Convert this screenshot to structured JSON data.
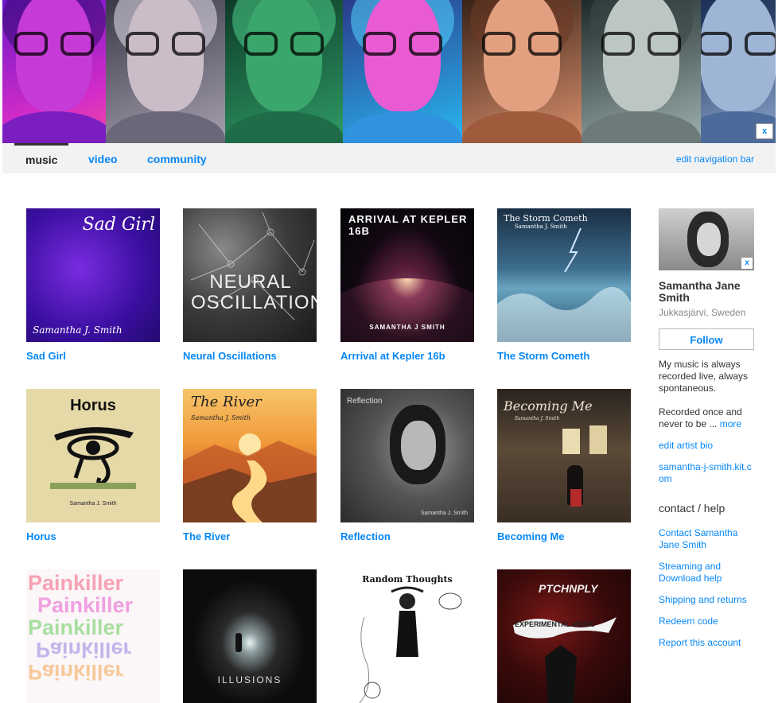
{
  "header": {
    "close_label": "x",
    "panel_colors": [
      "#b02bd8",
      "#8b8da0",
      "#3da86b",
      "#39a7e8",
      "#d8825c",
      "#8aa0a0",
      "#6b8fb8"
    ]
  },
  "nav": {
    "items": [
      {
        "label": "music"
      },
      {
        "label": "video"
      },
      {
        "label": "community"
      }
    ],
    "edit_label": "edit navigation bar"
  },
  "albums": [
    {
      "title": "Sad Girl",
      "cover_text": "Sad Girl",
      "cover_sub": "Samantha J. Smith"
    },
    {
      "title": "Neural Oscillations",
      "cover_text": "NEURAL OSCILLATIONS",
      "cover_sub": ""
    },
    {
      "title": "Arrrival at Kepler 16b",
      "cover_text": "ARRIVAL AT KEPLER 16B",
      "cover_sub": "SAMANTHA J SMITH"
    },
    {
      "title": "The Storm Cometh",
      "cover_text": "The Storm Cometh",
      "cover_sub": "Samantha J. Smith"
    },
    {
      "title": "Horus",
      "cover_text": "Horus",
      "cover_sub": "Samantha J. Smith"
    },
    {
      "title": "The River",
      "cover_text": "The River",
      "cover_sub": "Samantha J. Smith"
    },
    {
      "title": "Reflection",
      "cover_text": "Reflection",
      "cover_sub": "Samantha J. Smith"
    },
    {
      "title": "Becoming Me",
      "cover_text": "Becoming Me",
      "cover_sub": "Samantha J. Smith"
    },
    {
      "title": "",
      "cover_text": "Painkiller",
      "cover_sub": ""
    },
    {
      "title": "",
      "cover_text": "ILLUSIONS",
      "cover_sub": ""
    },
    {
      "title": "",
      "cover_text": "Random Thoughts",
      "cover_sub": ""
    },
    {
      "title": "",
      "cover_text": "PTCHNPLY",
      "cover_sub": "EXPERIMENTAL MUSIC"
    }
  ],
  "sidebar": {
    "photo_close": "x",
    "artist_name": "Samantha Jane Smith",
    "location": "Jukkasjärvi, Sweden",
    "follow_label": "Follow",
    "bio_p1": "My music is always recorded live, always spontaneous.",
    "bio_p2": "Recorded once and never to be ...",
    "more_label": "more",
    "edit_bio_label": "edit artist bio",
    "website": "samantha-j-smith.kit.com",
    "contact_heading": "contact / help",
    "links": [
      "Contact Samantha Jane Smith",
      "Streaming and Download help",
      "Shipping and returns",
      "Redeem code",
      "Report this account"
    ]
  }
}
